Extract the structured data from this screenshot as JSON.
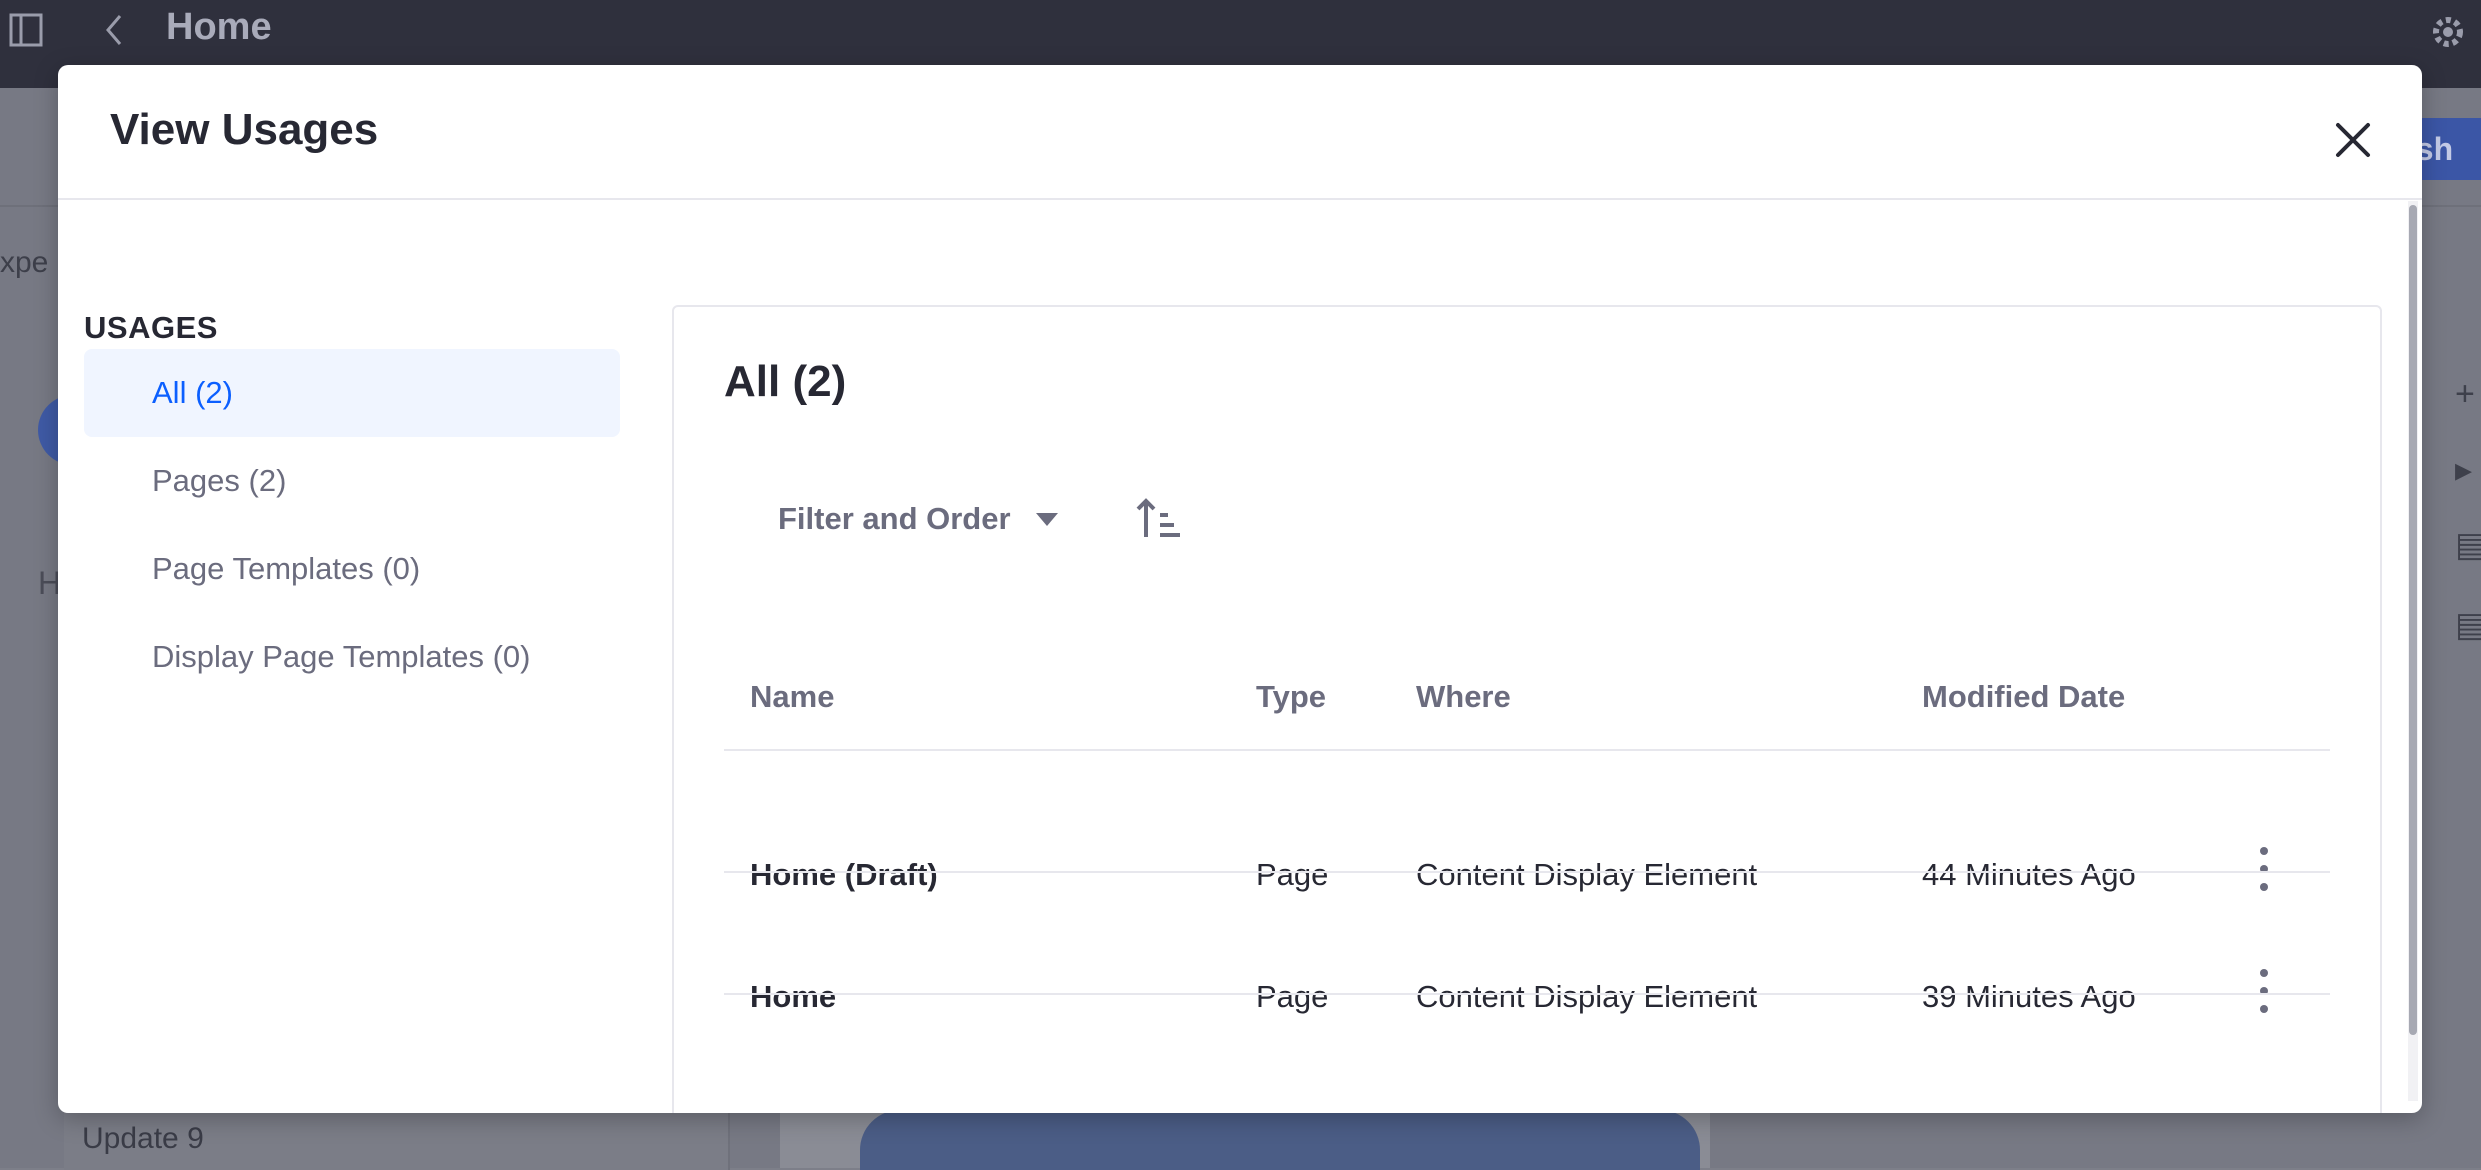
{
  "app": {
    "page_title": "Home",
    "publish_fragment": "lish",
    "left_fragment": "xpe",
    "left_fragment_h": "H",
    "update_text": "Update 9",
    "icons": [
      "sidebar-toggle-icon",
      "back-chevron-icon",
      "gear-icon"
    ]
  },
  "modal": {
    "title": "View Usages",
    "close_icon": "close-icon",
    "sidebar": {
      "heading": "USAGES",
      "items": [
        {
          "label": "All (2)",
          "active": true
        },
        {
          "label": "Pages (2)",
          "active": false
        },
        {
          "label": "Page Templates (0)",
          "active": false
        },
        {
          "label": "Display Page Templates (0)",
          "active": false
        }
      ]
    },
    "panel": {
      "title": "All (2)",
      "filter_label": "Filter and Order",
      "sort_icon": "sort-ascending-icon",
      "columns": [
        "Name",
        "Type",
        "Where",
        "Modified Date"
      ],
      "rows": [
        {
          "name": "Home (Draft)",
          "type": "Page",
          "where": "Content Display Element",
          "modified": "44 Minutes Ago"
        },
        {
          "name": "Home",
          "type": "Page",
          "where": "Content Display Element",
          "modified": "39 Minutes Ago"
        }
      ]
    }
  },
  "colors": {
    "accent": "#0b5fff",
    "active_bg": "#f0f5ff",
    "text_primary": "#272833",
    "text_secondary": "#6b6c7e",
    "topbar": "#2f303d",
    "overlay": "#777984"
  }
}
